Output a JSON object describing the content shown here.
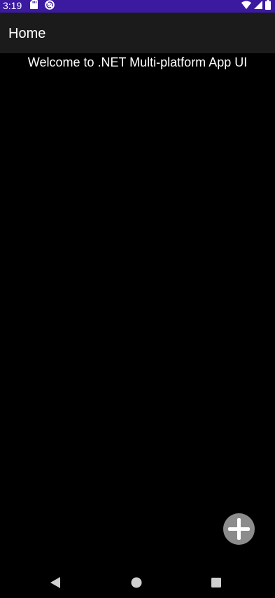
{
  "status_bar": {
    "time": "3:19",
    "background_color": "#3b1aa0",
    "left_icons": [
      "sd-card-icon",
      "do-not-disturb-icon"
    ],
    "right_icons": [
      "wifi-icon",
      "signal-icon",
      "battery-icon"
    ]
  },
  "app_bar": {
    "title": "Home",
    "background_color": "#1b1b1b"
  },
  "main": {
    "welcome_text": "Welcome to .NET Multi-platform App UI"
  },
  "fab": {
    "icon": "plus-icon",
    "color": "#8c8c8c"
  },
  "nav_bar": {
    "buttons": [
      "back-icon",
      "home-icon",
      "recents-icon"
    ]
  }
}
